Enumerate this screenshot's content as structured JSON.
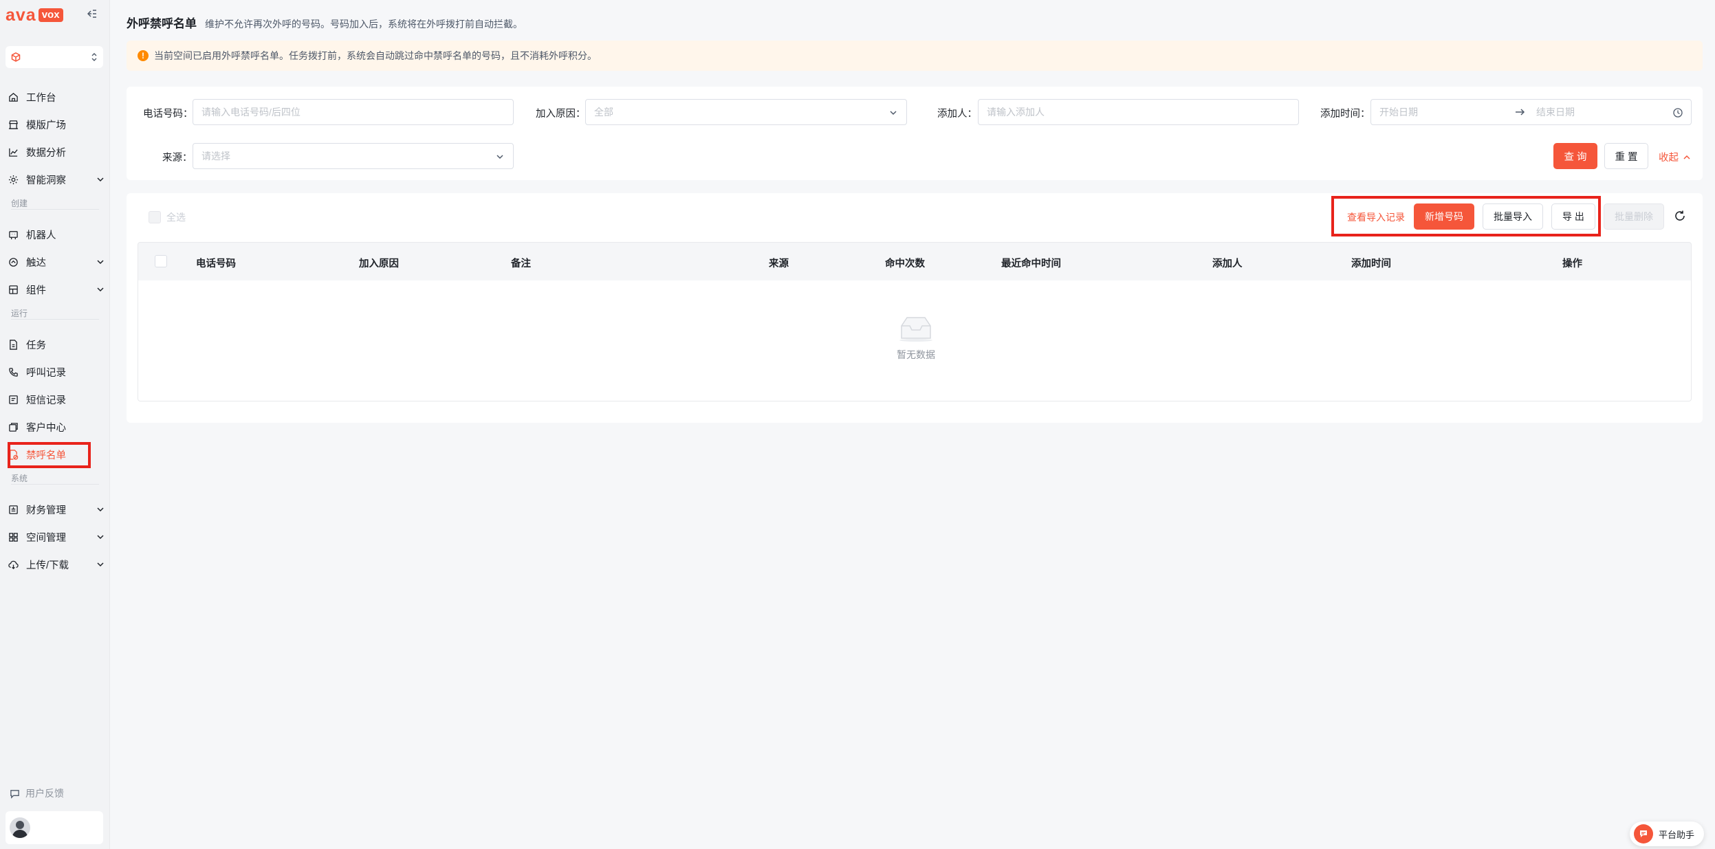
{
  "brand": {
    "logo_part1": "ava",
    "logo_part2": "vox"
  },
  "sidebar": {
    "sections": {
      "create": "创建",
      "run": "运行",
      "system": "系统"
    },
    "items": [
      {
        "label": "工作台"
      },
      {
        "label": "模版广场"
      },
      {
        "label": "数据分析"
      },
      {
        "label": "智能洞察"
      },
      {
        "label": "机器人"
      },
      {
        "label": "触达"
      },
      {
        "label": "组件"
      },
      {
        "label": "任务"
      },
      {
        "label": "呼叫记录"
      },
      {
        "label": "短信记录"
      },
      {
        "label": "客户中心"
      },
      {
        "label": "禁呼名单"
      },
      {
        "label": "财务管理"
      },
      {
        "label": "空间管理"
      },
      {
        "label": "上传/下载"
      }
    ],
    "feedback": "用户反馈"
  },
  "header": {
    "title": "外呼禁呼名单",
    "description": "维护不允许再次外呼的号码。号码加入后，系统将在外呼拨打前自动拦截。"
  },
  "alert": {
    "text": "当前空间已启用外呼禁呼名单。任务拨打前，系统会自动跳过命中禁呼名单的号码，且不消耗外呼积分。"
  },
  "filters": {
    "phone_label": "电话号码：",
    "phone_placeholder": "请输入电话号码/后四位",
    "reason_label": "加入原因：",
    "reason_value": "全部",
    "adder_label": "添加人：",
    "adder_placeholder": "请输入添加人",
    "time_label": "添加时间：",
    "start_placeholder": "开始日期",
    "end_placeholder": "结束日期",
    "source_label": "来源：",
    "source_placeholder": "请选择",
    "query": "查 询",
    "reset": "重 置",
    "collapse": "收起"
  },
  "toolbar": {
    "select_all": "全选",
    "view_import_records": "查看导入记录",
    "add_number": "新增号码",
    "batch_import": "批量导入",
    "export": "导 出",
    "batch_delete": "批量删除"
  },
  "table": {
    "columns": [
      "电话号码",
      "加入原因",
      "备注",
      "来源",
      "命中次数",
      "最近命中时间",
      "添加人",
      "添加时间",
      "操作"
    ],
    "empty_text": "暂无数据"
  },
  "assistant": {
    "label": "平台助手"
  },
  "colors": {
    "accent": "#f5563a",
    "highlight": "#e8231b",
    "alert_bg": "#fff6eb",
    "alert_icon": "#ff8a00"
  }
}
